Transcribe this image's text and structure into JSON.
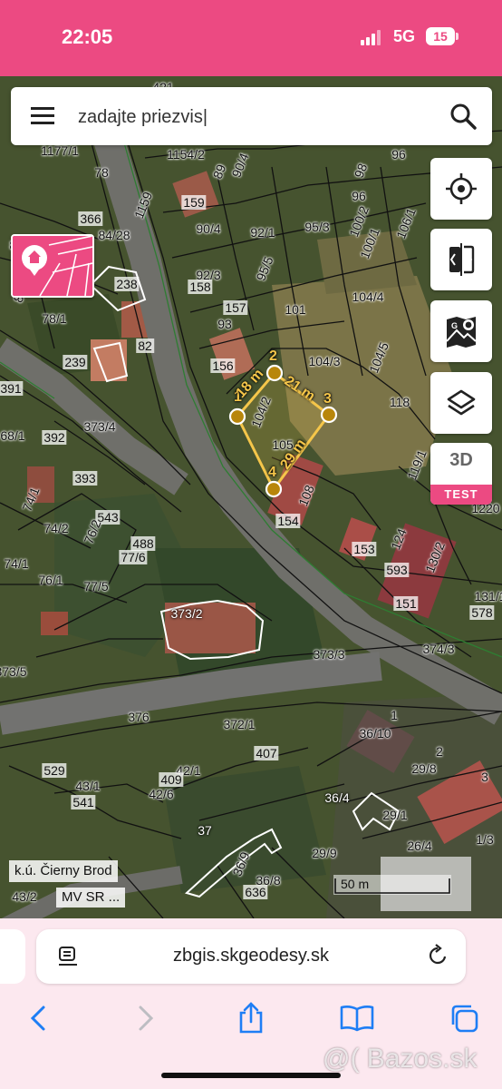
{
  "status_bar": {
    "time": "22:05",
    "network": "5G",
    "battery": "15"
  },
  "search": {
    "placeholder": "zadajte priezvis",
    "value": "zadajte priezvis|"
  },
  "map": {
    "parcels": [
      {
        "id": "p1",
        "text": "421"
      },
      {
        "id": "p2",
        "text": "1177/1"
      },
      {
        "id": "p3",
        "text": "1154/2"
      },
      {
        "id": "p4",
        "text": "96"
      },
      {
        "id": "p5",
        "text": "78"
      },
      {
        "id": "p6",
        "text": "89"
      },
      {
        "id": "p7",
        "text": "90/4"
      },
      {
        "id": "p8",
        "text": "98"
      },
      {
        "id": "p9",
        "text": "159"
      },
      {
        "id": "p10",
        "text": "1159"
      },
      {
        "id": "p11",
        "text": "366"
      },
      {
        "id": "p12",
        "text": "96"
      },
      {
        "id": "p13",
        "text": "84/28"
      },
      {
        "id": "p14",
        "text": "90/4"
      },
      {
        "id": "p15",
        "text": "92/1"
      },
      {
        "id": "p16",
        "text": "95/3"
      },
      {
        "id": "p17",
        "text": "100/2"
      },
      {
        "id": "p18",
        "text": "100/1"
      },
      {
        "id": "p19",
        "text": "106/1"
      },
      {
        "id": "p20",
        "text": "80/2"
      },
      {
        "id": "p21",
        "text": "92/3"
      },
      {
        "id": "p22",
        "text": "95/5"
      },
      {
        "id": "p23",
        "text": "238"
      },
      {
        "id": "p24",
        "text": "158"
      },
      {
        "id": "p25",
        "text": "80/1"
      },
      {
        "id": "p26",
        "text": "104/4"
      },
      {
        "id": "p27",
        "text": "157"
      },
      {
        "id": "p28",
        "text": "101"
      },
      {
        "id": "p29",
        "text": "78/1"
      },
      {
        "id": "p30",
        "text": "93"
      },
      {
        "id": "p31",
        "text": "82"
      },
      {
        "id": "p32",
        "text": "239"
      },
      {
        "id": "p33",
        "text": "156"
      },
      {
        "id": "p34",
        "text": "104/3"
      },
      {
        "id": "p35",
        "text": "104/5"
      },
      {
        "id": "p36",
        "text": "391"
      },
      {
        "id": "p37",
        "text": "104/2"
      },
      {
        "id": "p38",
        "text": "118"
      },
      {
        "id": "p39",
        "text": "373/4"
      },
      {
        "id": "p40",
        "text": "68/1"
      },
      {
        "id": "p41",
        "text": "392"
      },
      {
        "id": "p42",
        "text": "105"
      },
      {
        "id": "p43",
        "text": "119/1"
      },
      {
        "id": "p44",
        "text": "393"
      },
      {
        "id": "p45",
        "text": "108"
      },
      {
        "id": "p46",
        "text": "1220"
      },
      {
        "id": "p47",
        "text": "74/1"
      },
      {
        "id": "p48",
        "text": "543"
      },
      {
        "id": "p49",
        "text": "154"
      },
      {
        "id": "p50",
        "text": "74/2"
      },
      {
        "id": "p51",
        "text": "76/2"
      },
      {
        "id": "p52",
        "text": "488"
      },
      {
        "id": "p53",
        "text": "153"
      },
      {
        "id": "p54",
        "text": "124"
      },
      {
        "id": "p55",
        "text": "130/2"
      },
      {
        "id": "p56",
        "text": "74/1"
      },
      {
        "id": "p57",
        "text": "77/6"
      },
      {
        "id": "p58",
        "text": "593"
      },
      {
        "id": "p59",
        "text": "76/1"
      },
      {
        "id": "p60",
        "text": "77/5"
      },
      {
        "id": "p61",
        "text": "131/1"
      },
      {
        "id": "p62",
        "text": "578"
      },
      {
        "id": "p63",
        "text": "373/2"
      },
      {
        "id": "p64",
        "text": "151"
      },
      {
        "id": "p65",
        "text": "374/3"
      },
      {
        "id": "p66",
        "text": "373/5"
      },
      {
        "id": "p67",
        "text": "373/3"
      },
      {
        "id": "p68",
        "text": "376"
      },
      {
        "id": "p69",
        "text": "372/1"
      },
      {
        "id": "p70",
        "text": "1"
      },
      {
        "id": "p71",
        "text": "36/10"
      },
      {
        "id": "p72",
        "text": "407"
      },
      {
        "id": "p73",
        "text": "2"
      },
      {
        "id": "p74",
        "text": "529"
      },
      {
        "id": "p75",
        "text": "42/1"
      },
      {
        "id": "p76",
        "text": "29/8"
      },
      {
        "id": "p77",
        "text": "409"
      },
      {
        "id": "p78",
        "text": "43/1"
      },
      {
        "id": "p79",
        "text": "3"
      },
      {
        "id": "p80",
        "text": "42/6"
      },
      {
        "id": "p81",
        "text": "36/4"
      },
      {
        "id": "p82",
        "text": "541"
      },
      {
        "id": "p83",
        "text": "29/1"
      },
      {
        "id": "p84",
        "text": "26/4"
      },
      {
        "id": "p85",
        "text": "37"
      },
      {
        "id": "p86",
        "text": "1/3"
      },
      {
        "id": "p87",
        "text": "36/9"
      },
      {
        "id": "p88",
        "text": "29/9"
      },
      {
        "id": "p89",
        "text": "36/8"
      },
      {
        "id": "p90",
        "text": "636"
      },
      {
        "id": "p91",
        "text": "43/2"
      }
    ],
    "measurement": {
      "vertices": [
        "1",
        "2",
        "3",
        "4"
      ],
      "segments": [
        "18 m",
        "21 m",
        "29 m"
      ]
    },
    "cadastral_area": "k.ú. Čierny Brod",
    "attribution": "MV SR ...",
    "scale": "50 m"
  },
  "tools": {
    "locate_icon": "crosshair-icon",
    "compare_icon": "split-screen-icon",
    "google_maps_icon": "map-pin-icon",
    "layers_icon": "layers-icon",
    "btn_3d": "3D",
    "badge_test": "TEST"
  },
  "browser": {
    "url": "zbgis.skgeodesy.sk"
  },
  "watermark": "@( Bazos.sk",
  "colors": {
    "brand": "#ec4a82",
    "measure": "#f5c64a",
    "measure_vertex": "#b8860b"
  }
}
